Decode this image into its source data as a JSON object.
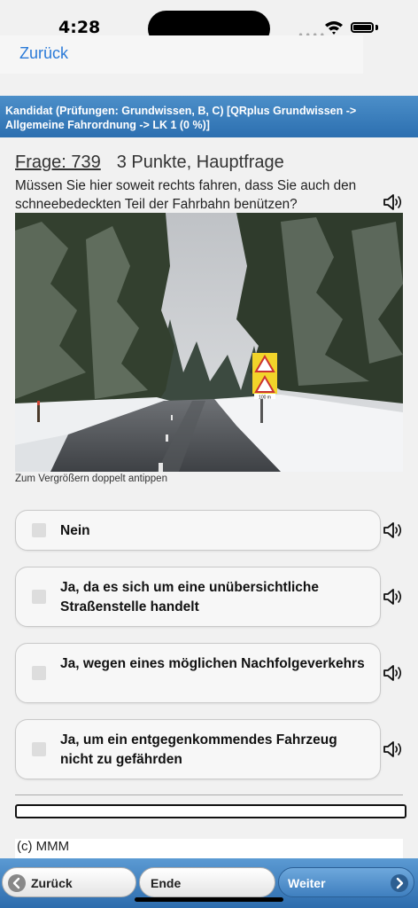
{
  "status": {
    "time": "4:28",
    "dots": "••••"
  },
  "nav": {
    "back_label": "Zurück"
  },
  "header": {
    "text": "Kandidat (Prüfungen: Grundwissen, B, C) [QRplus Grundwissen -> Allgemeine Fahrordnung -> LK 1 (0 %)]"
  },
  "question": {
    "number_label": "Frage: 739",
    "points_label": "3 Punkte, Hauptfrage",
    "text": "Müssen Sie hier soweit rechts fahren, dass Sie auch den schneebedeckten Teil der Fahrbahn benützen?"
  },
  "image": {
    "hint": "Zum Vergrößern doppelt antippen",
    "sign_plate": "100 m"
  },
  "answers": [
    {
      "label": "Nein",
      "checked": false
    },
    {
      "label": "Ja, da es sich um eine unübersichtliche Straßenstelle handelt",
      "checked": false
    },
    {
      "label": "Ja, wegen eines möglichen Nachfolgeverkehrs",
      "checked": false
    },
    {
      "label": "Ja, um ein entgegenkommendes Fahrzeug nicht zu gefährden",
      "checked": false
    }
  ],
  "progress": {
    "value": 0
  },
  "footer": {
    "copyright": "(c) MMM"
  },
  "toolbar": {
    "back_label": "Zurück",
    "end_label": "Ende",
    "next_label": "Weiter"
  },
  "colors": {
    "accent": "#2a7ad8",
    "header": "#2c6fb0",
    "toolbar": "#3f7fbf"
  },
  "icons": {
    "speaker": "speaker-icon",
    "back": "chevron-left-icon",
    "next": "chevron-right-icon"
  }
}
